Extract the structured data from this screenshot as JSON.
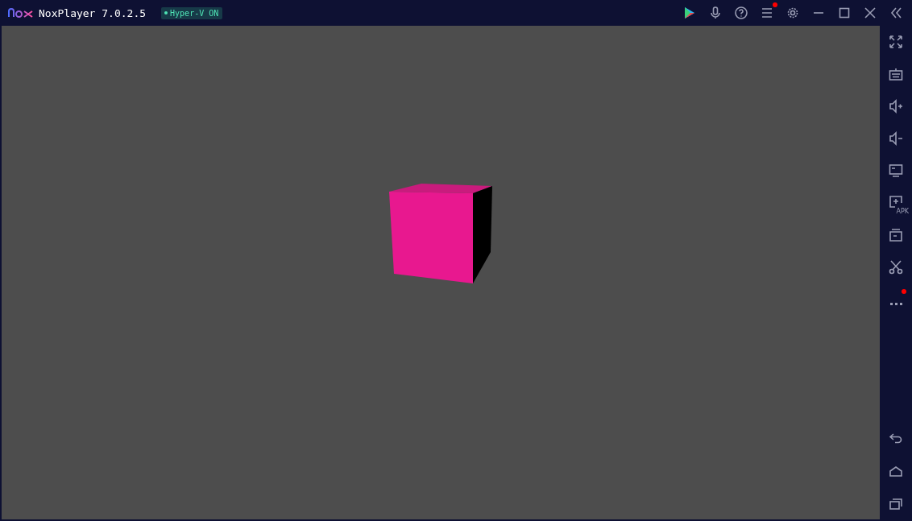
{
  "window": {
    "title": "NoxPlayer 7.0.2.5",
    "badge": "Hyper-V ON"
  },
  "titlebar_buttons": [
    {
      "kind": "play",
      "dot": false
    },
    {
      "kind": "mic",
      "dot": false
    },
    {
      "kind": "help",
      "dot": false
    },
    {
      "kind": "menu",
      "dot": true
    },
    {
      "kind": "settings",
      "dot": false
    },
    {
      "kind": "minimize",
      "dot": false
    },
    {
      "kind": "maximize",
      "dot": false
    },
    {
      "kind": "close",
      "dot": false
    },
    {
      "kind": "collapse",
      "dot": false
    }
  ],
  "sidebar_tools": [
    {
      "kind": "fullscreen",
      "dot": false
    },
    {
      "kind": "keyboard",
      "dot": false
    },
    {
      "kind": "volup",
      "dot": false
    },
    {
      "kind": "voldown",
      "dot": false
    },
    {
      "kind": "screen",
      "dot": false
    },
    {
      "kind": "apk",
      "label": "APK",
      "dot": false
    },
    {
      "kind": "multi",
      "dot": false
    },
    {
      "kind": "cut",
      "dot": false
    },
    {
      "kind": "more",
      "dot": true
    }
  ],
  "nav_buttons": [
    {
      "kind": "back"
    },
    {
      "kind": "home"
    },
    {
      "kind": "recents"
    }
  ]
}
